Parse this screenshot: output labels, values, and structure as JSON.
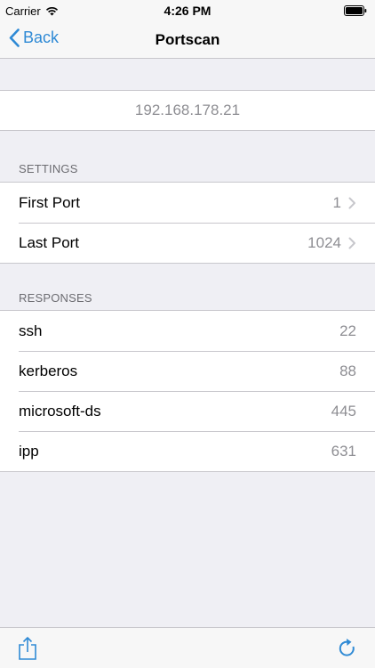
{
  "status_bar": {
    "carrier": "Carrier",
    "time": "4:26 PM"
  },
  "nav": {
    "back_label": "Back",
    "title": "Portscan"
  },
  "host": {
    "ip": "192.168.178.21"
  },
  "settings": {
    "header": "SETTINGS",
    "rows": [
      {
        "label": "First Port",
        "value": "1"
      },
      {
        "label": "Last Port",
        "value": "1024"
      }
    ]
  },
  "responses": {
    "header": "RESPONSES",
    "rows": [
      {
        "label": "ssh",
        "value": "22"
      },
      {
        "label": "kerberos",
        "value": "88"
      },
      {
        "label": "microsoft-ds",
        "value": "445"
      },
      {
        "label": "ipp",
        "value": "631"
      }
    ]
  },
  "colors": {
    "accent": "#2f8ad5",
    "secondary_text": "#8e8e93",
    "background": "#efeff4"
  },
  "icons": {
    "status": [
      "wifi-icon",
      "battery-icon"
    ],
    "nav": [
      "chevron-left-icon"
    ],
    "toolbar": [
      "share-icon",
      "refresh-icon"
    ]
  }
}
